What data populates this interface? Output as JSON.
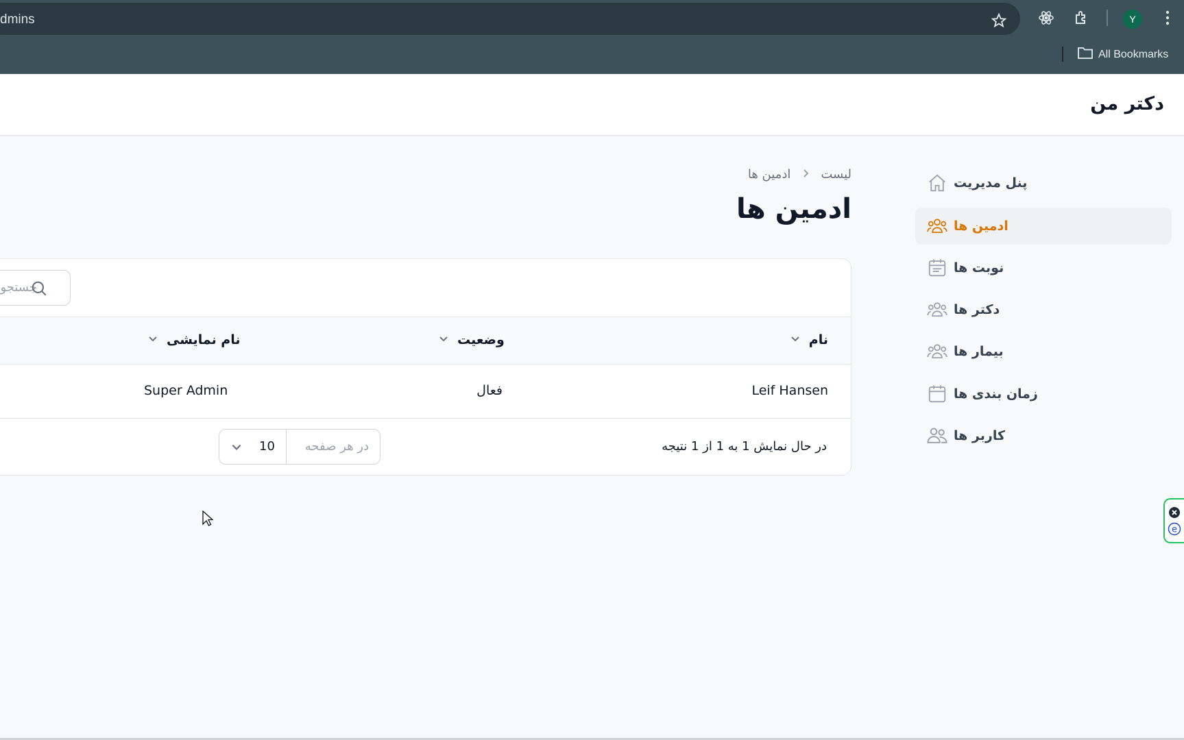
{
  "browser": {
    "url_fragment": "dmins",
    "profile_initial": "Y",
    "bookmarks_label": "All Bookmarks"
  },
  "app": {
    "brand": "دکتر من"
  },
  "sidebar": {
    "items": [
      {
        "label": "پنل مدیریت",
        "icon": "home-icon",
        "active": false
      },
      {
        "label": "ادمین ها",
        "icon": "users-icon",
        "active": true
      },
      {
        "label": "نوبت ها",
        "icon": "calendar-list-icon",
        "active": false
      },
      {
        "label": "دکتر ها",
        "icon": "users-icon",
        "active": false
      },
      {
        "label": "بیمار ها",
        "icon": "users-icon",
        "active": false
      },
      {
        "label": "زمان بندی ها",
        "icon": "calendar-icon",
        "active": false
      },
      {
        "label": "کاربر ها",
        "icon": "user-group-icon",
        "active": false
      }
    ]
  },
  "breadcrumb": {
    "parent": "ادمین ها",
    "current": "لیست"
  },
  "page": {
    "title": "ادمین ها"
  },
  "search": {
    "placeholder": "جستجو"
  },
  "table": {
    "columns": [
      {
        "key": "name",
        "label": "نام"
      },
      {
        "key": "status",
        "label": "وضعیت"
      },
      {
        "key": "display_name",
        "label": "نام نمایشی"
      }
    ],
    "rows": [
      {
        "name": "Leif Hansen",
        "status": "فعال",
        "display_name": "Super Admin"
      }
    ]
  },
  "pagination": {
    "info": "در حال نمایش 1 به 1 از 1 نتیجه",
    "per_page_label": "در هر صفحه",
    "per_page_value": "10"
  },
  "colors": {
    "accent": "#d97706",
    "chrome": "#3c5159"
  }
}
